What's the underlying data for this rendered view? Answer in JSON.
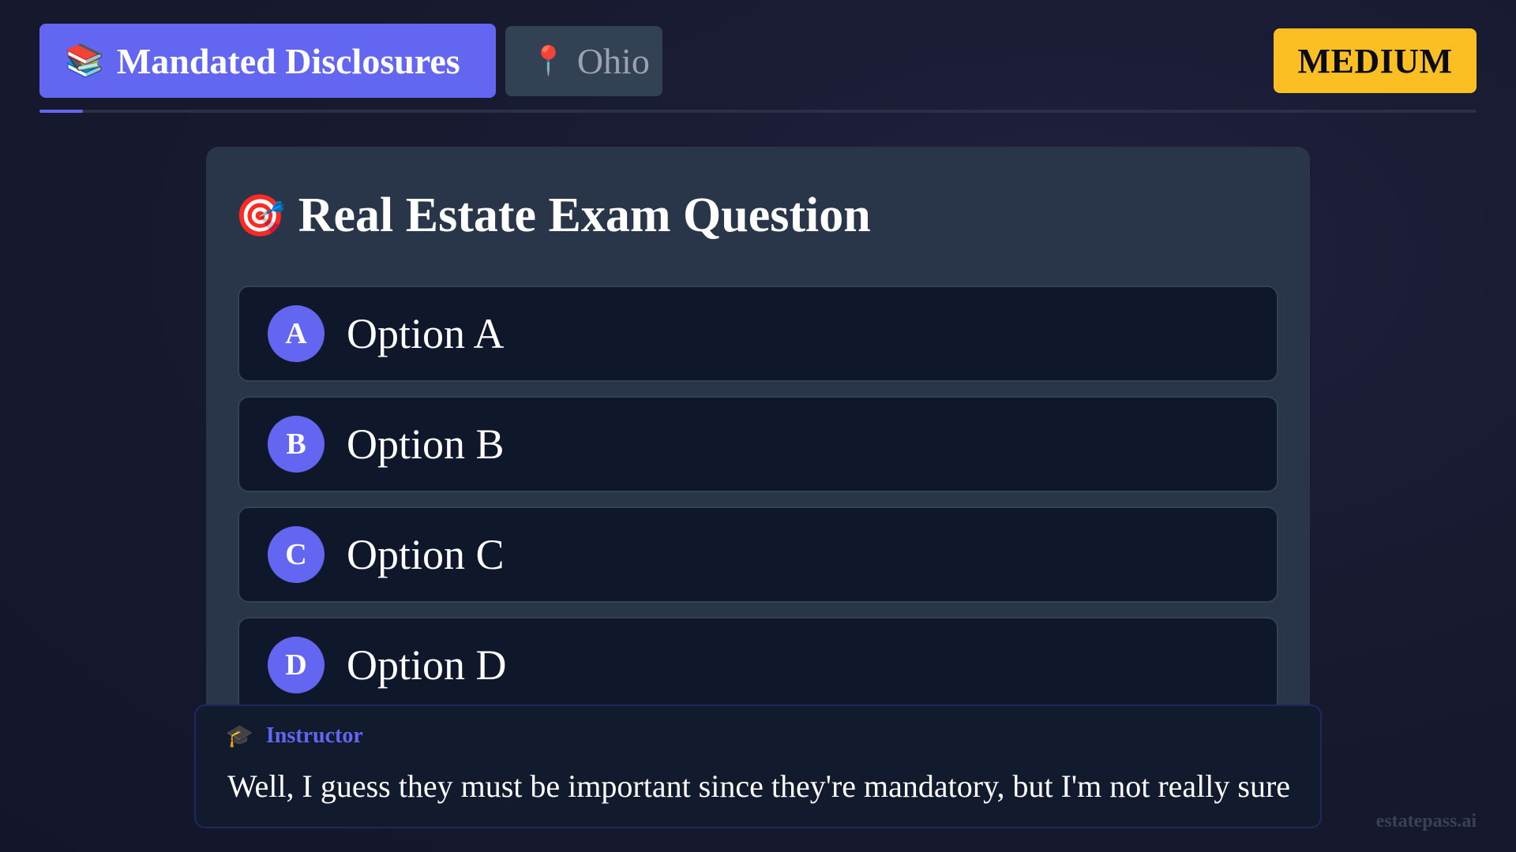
{
  "header": {
    "topic_tab": {
      "emoji": "📚",
      "label": "Mandated Disclosures"
    },
    "state_tab": {
      "emoji": "📍",
      "label": "Ohio"
    },
    "difficulty_badge": {
      "label": "MEDIUM",
      "color": "#fbbf24"
    },
    "progress": {
      "fraction": 0.03,
      "color": "#6366f1"
    }
  },
  "question_card": {
    "emoji": "🎯",
    "title": "Real Estate Exam Question",
    "options": [
      {
        "letter": "A",
        "text": "Option A"
      },
      {
        "letter": "B",
        "text": "Option B"
      },
      {
        "letter": "C",
        "text": "Option C"
      },
      {
        "letter": "D",
        "text": "Option D"
      }
    ]
  },
  "instructor": {
    "emoji": "🎓",
    "name": "Instructor",
    "message": "Well, I guess they must be important since they're mandatory, but I'm not really sure"
  },
  "watermark": "estatepass.ai",
  "colors": {
    "accent": "#6366f1",
    "card_bg": "#293548",
    "option_bg": "#0f172a",
    "page_bg": "#181a30"
  }
}
